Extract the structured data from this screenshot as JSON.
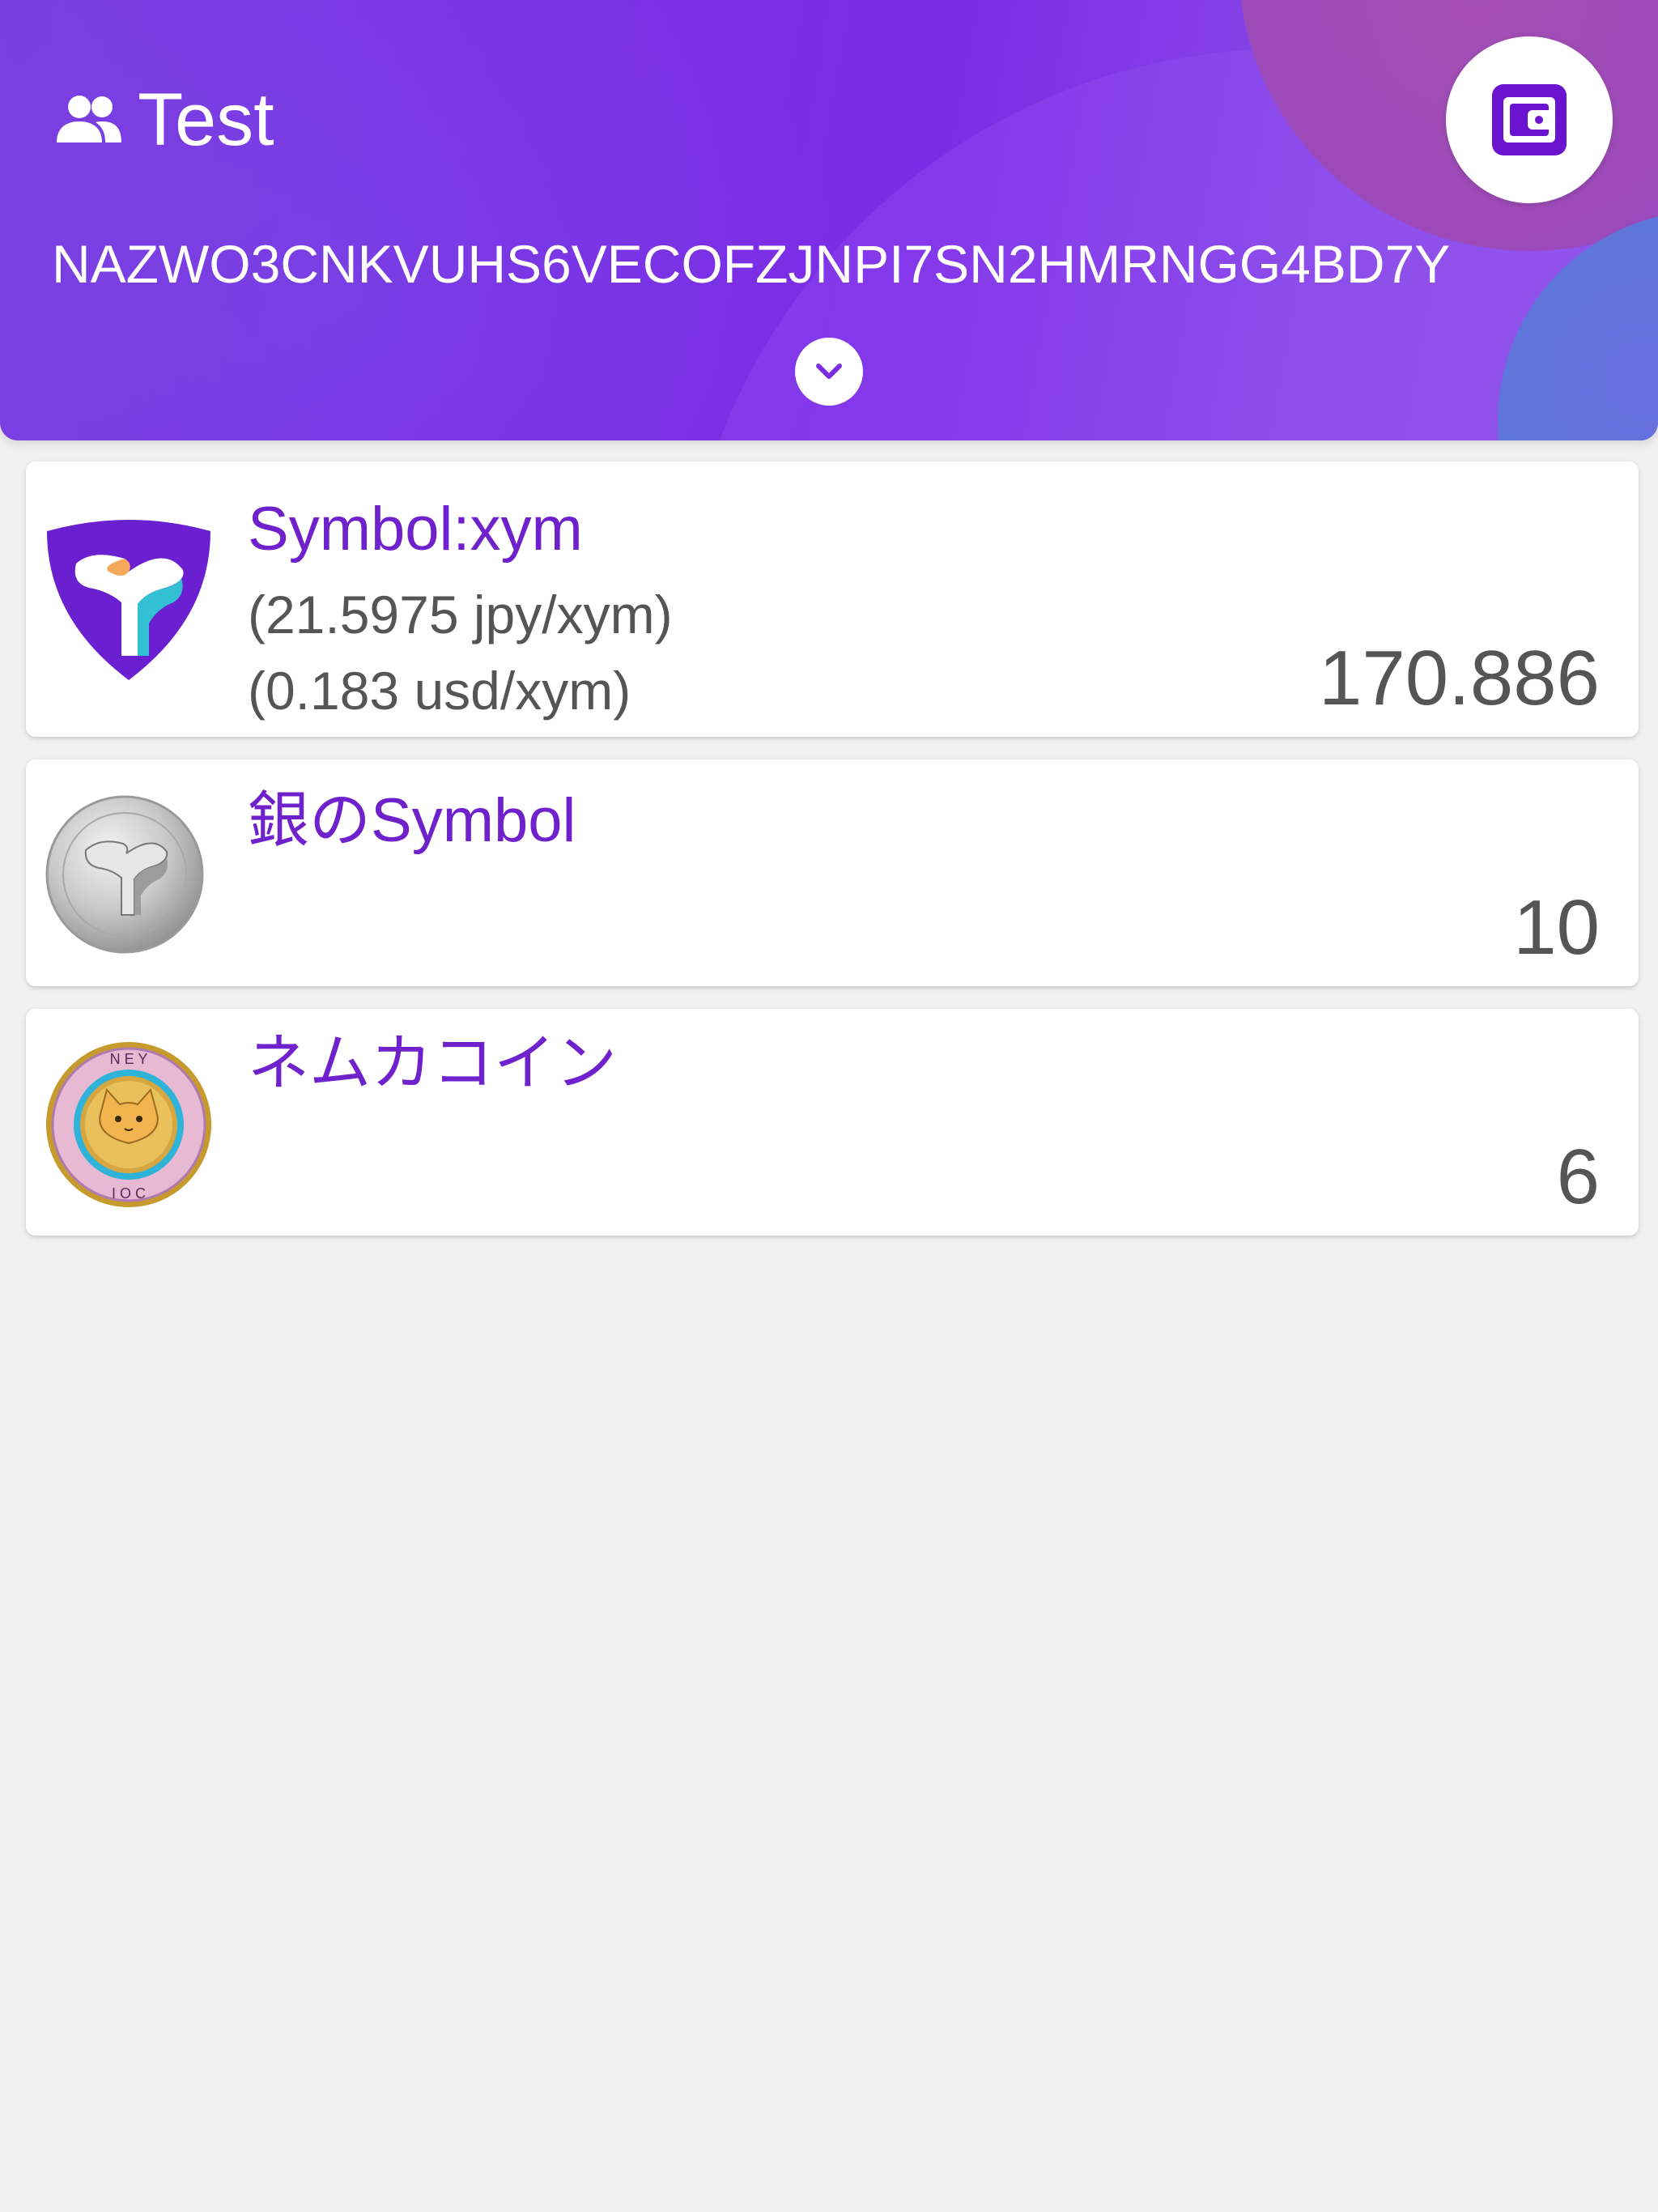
{
  "header": {
    "account_icon": "people-icon",
    "account_name": "Test",
    "address": "NAZWO3CNKVUHS6VECOFZJNPI7SN2HMRNGG4BD7Y",
    "wallet_icon": "wallet-icon",
    "expand_icon": "chevron-down-icon",
    "colors": {
      "header_gradient_start": "#7a3ee0",
      "header_gradient_end": "#9453e9",
      "accent": "#6a1fd0"
    }
  },
  "tokens": [
    {
      "name": "Symbol:xym",
      "rate_jpy": "(21.5975 jpy/xym)",
      "rate_usd": "(0.183 usd/xym)",
      "balance": "170.886",
      "logo": "symbol-logo"
    },
    {
      "name": "銀のSymbol",
      "balance": "10",
      "logo": "silver-symbol-coin"
    },
    {
      "name": "ネムカコイン",
      "balance": "6",
      "logo": "nemuka-coin"
    }
  ],
  "colors": {
    "token_name": "#6f22cc",
    "text_gray": "#555555",
    "background": "#f1f1f1"
  }
}
